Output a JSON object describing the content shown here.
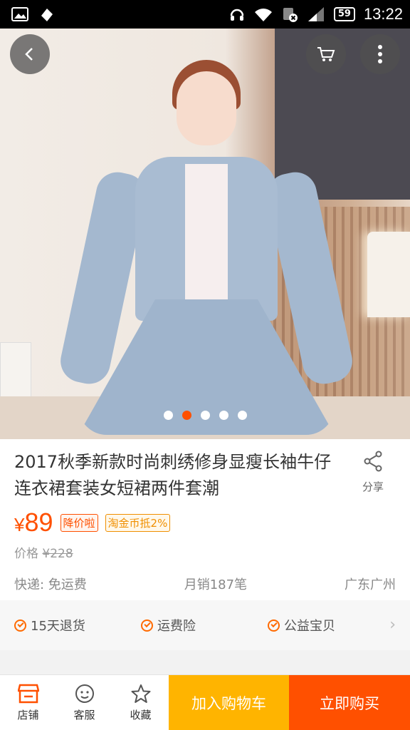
{
  "status_bar": {
    "time": "13:22",
    "battery": "59"
  },
  "product": {
    "title": "2017秋季新款时尚刺绣修身显瘦长袖牛仔连衣裙套装女短裙两件套潮",
    "share_label": "分享",
    "currency": "¥",
    "price": "89",
    "tags": [
      "降价啦",
      "淘金币抵2%"
    ],
    "original_price_label": "价格",
    "original_price": "¥228",
    "shipping": "快递: 免运费",
    "monthly_sales": "月销187笔",
    "location": "广东广州"
  },
  "gallery": {
    "total": 5,
    "active_index": 1
  },
  "guarantees": [
    "15天退货",
    "运费险",
    "公益宝贝"
  ],
  "bottom_bar": {
    "shop": "店铺",
    "service": "客服",
    "favorite": "收藏",
    "add_to_cart": "加入购物车",
    "buy_now": "立即购买"
  },
  "colors": {
    "accent": "#ff5000",
    "cart": "#ffb400"
  }
}
